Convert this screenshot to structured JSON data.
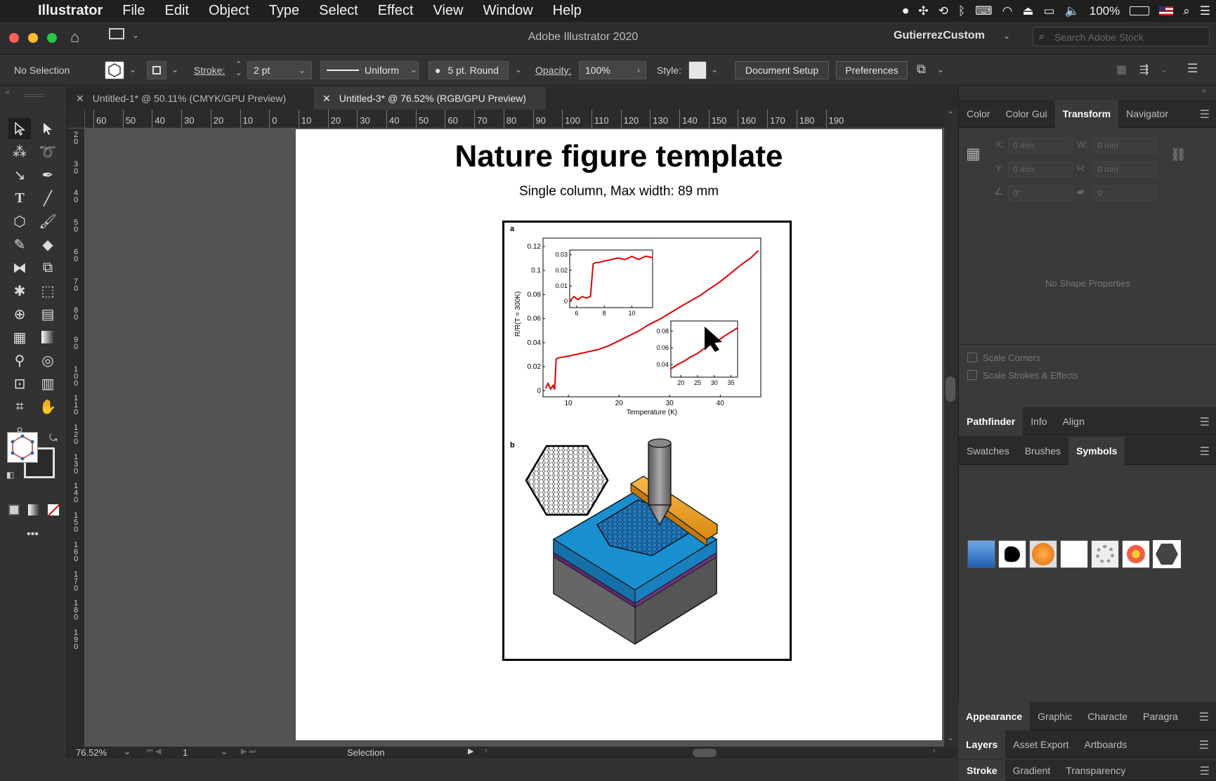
{
  "menubar": {
    "apple": "",
    "app_name": "Illustrator",
    "items": [
      "File",
      "Edit",
      "Object",
      "Type",
      "Select",
      "Effect",
      "View",
      "Window",
      "Help"
    ],
    "battery": "100%"
  },
  "titlebar": {
    "title": "Adobe Illustrator 2020",
    "workspace": "GutierrezCustom",
    "search_placeholder": "Search Adobe Stock"
  },
  "controlbar": {
    "selection": "No Selection",
    "stroke_label": "Stroke:",
    "stroke_value": "2 pt",
    "profile": "Uniform",
    "brush": "5 pt. Round",
    "opacity_label": "Opacity:",
    "opacity_value": "100%",
    "style_label": "Style:",
    "document_setup": "Document Setup",
    "preferences": "Preferences"
  },
  "tabs": [
    {
      "label": "Untitled-1* @ 50.11% (CMYK/GPU Preview)",
      "active": false
    },
    {
      "label": "Untitled-3* @ 76.52% (RGB/GPU Preview)",
      "active": true
    }
  ],
  "ruler": {
    "h_ticks": [
      "60",
      "50",
      "40",
      "30",
      "20",
      "10",
      "0",
      "10",
      "20",
      "30",
      "40",
      "50",
      "60",
      "70",
      "80",
      "90",
      "100",
      "110",
      "120",
      "130",
      "140",
      "150",
      "160",
      "170",
      "180",
      "190"
    ],
    "v_ticks": [
      "2 0",
      "3 0",
      "4 0",
      "5 0",
      "6 0",
      "7 0",
      "8 0",
      "9 0",
      "1 0 0",
      "1 1 0",
      "1 2 0",
      "1 3 0",
      "1 4 0",
      "1 5 0",
      "1 6 0",
      "1 7 0",
      "1 8 0",
      "1 9 0"
    ]
  },
  "artboard": {
    "heading": "Nature figure template",
    "subheading": "Single column, Max width: 89 mm",
    "panel_a": "a",
    "panel_b": "b"
  },
  "chart_data": [
    {
      "type": "line",
      "xlabel": "Temperature (K)",
      "ylabel": "R/R(T = 300K)",
      "xlim": [
        5,
        48
      ],
      "ylim": [
        -0.005,
        0.127
      ],
      "xticks": [
        "10",
        "20",
        "30",
        "40"
      ],
      "yticks": [
        "0",
        "0.02",
        "0.04",
        "0.06",
        "0.08",
        "0.1",
        "0.12"
      ],
      "series": [
        {
          "x": [
            5.5,
            6,
            6.5,
            7,
            7.3,
            7.6,
            8,
            9,
            10,
            12,
            14,
            16,
            18,
            20,
            22,
            24,
            26,
            28,
            30,
            32,
            34,
            36,
            38,
            40,
            42,
            44,
            46,
            47.5
          ],
          "values": [
            0.002,
            0.006,
            0.001,
            0.004,
            0.0005,
            0.026,
            0.027,
            0.028,
            0.029,
            0.031,
            0.033,
            0.035,
            0.038,
            0.042,
            0.046,
            0.05,
            0.055,
            0.059,
            0.064,
            0.069,
            0.074,
            0.079,
            0.085,
            0.091,
            0.098,
            0.105,
            0.111,
            0.117
          ],
          "color": "#e00000"
        }
      ]
    },
    {
      "type": "line",
      "xlim": [
        5.5,
        11.5
      ],
      "ylim": [
        -0.004,
        0.033
      ],
      "xticks": [
        "6",
        "8",
        "10"
      ],
      "yticks": [
        "0",
        "0.01",
        "0.02",
        "0.03"
      ],
      "series": [
        {
          "x": [
            5.5,
            5.8,
            6.1,
            6.4,
            6.7,
            7,
            7.2,
            7.4,
            7.6,
            8,
            8.5,
            9,
            9.5,
            10,
            10.5,
            11,
            11.5
          ],
          "values": [
            0.0,
            0.003,
            0.001,
            0.003,
            0.002,
            0.003,
            0.024,
            0.025,
            0.025,
            0.026,
            0.027,
            0.028,
            0.027,
            0.029,
            0.027,
            0.029,
            0.028
          ],
          "color": "#e00000"
        }
      ]
    },
    {
      "type": "line",
      "xlim": [
        17,
        37
      ],
      "ylim": [
        0.025,
        0.092
      ],
      "xticks": [
        "20",
        "25",
        "30",
        "35"
      ],
      "yticks": [
        "0.04",
        "0.06",
        "0.08"
      ],
      "series": [
        {
          "x": [
            17,
            19,
            21,
            23,
            25,
            27,
            29,
            31,
            33,
            35,
            37
          ],
          "values": [
            0.035,
            0.04,
            0.044,
            0.049,
            0.053,
            0.059,
            0.064,
            0.068,
            0.074,
            0.079,
            0.084
          ],
          "color": "#e00000"
        }
      ]
    }
  ],
  "statusbar": {
    "zoom": "76.52%",
    "page": "1",
    "tool": "Selection"
  },
  "panels": {
    "group1_tabs": [
      "Color",
      "Color Gui",
      "Transform",
      "Navigator"
    ],
    "x_label": "X:",
    "y_label": "Y:",
    "w_label": "W:",
    "h_label": "H:",
    "x_value": "0 mm",
    "y_value": "0 mm",
    "w_value": "0 mm",
    "h_value": "0 mm",
    "angle_value": "0°",
    "shear_value": "0°",
    "no_shape": "No Shape Properties",
    "scale_corners": "Scale Corners",
    "scale_strokes": "Scale Strokes & Effects",
    "group2_tabs": [
      "Pathfinder",
      "Info",
      "Align"
    ],
    "group3_tabs": [
      "Swatches",
      "Brushes",
      "Symbols"
    ],
    "group4_tabs": [
      "Stroke",
      "Gradient",
      "Transparency"
    ],
    "group5_tabs": [
      "Appearance",
      "Graphic",
      "Characte",
      "Paragra"
    ],
    "group6_tabs": [
      "Layers",
      "Asset Export",
      "Artboards"
    ]
  }
}
